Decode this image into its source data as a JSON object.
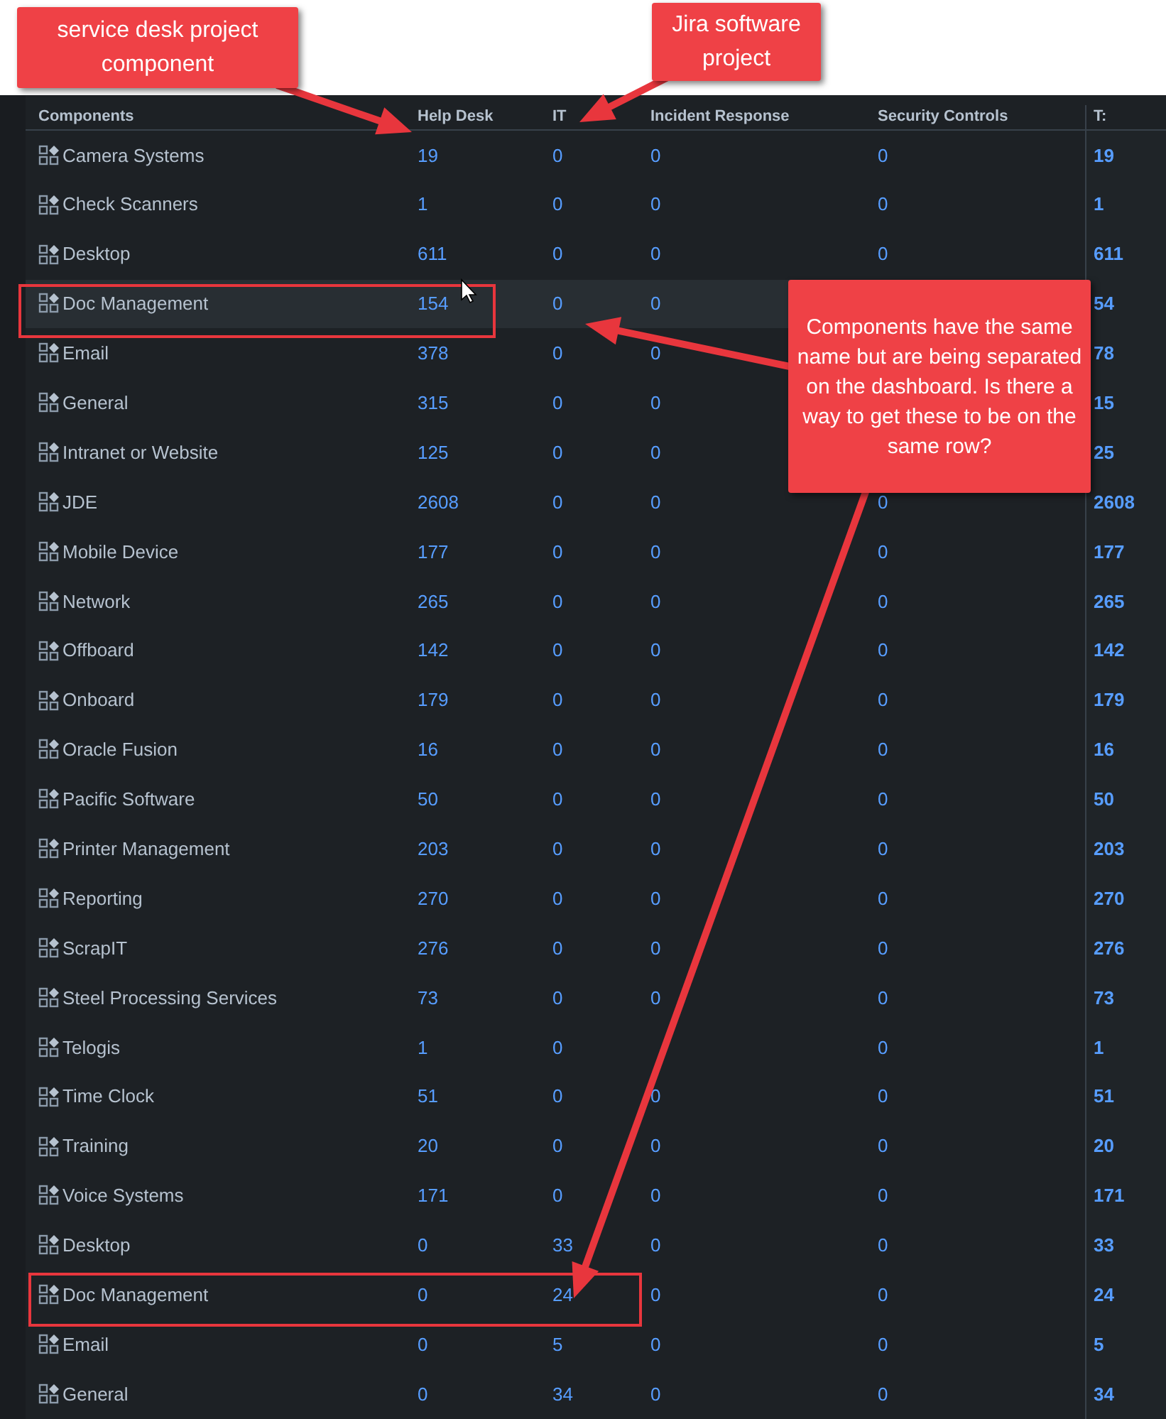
{
  "table": {
    "columns": [
      "Components",
      "Help Desk",
      "IT",
      "Incident Response",
      "Security Controls",
      "T:"
    ],
    "rows": [
      {
        "cells": [
          "Camera Systems",
          "19",
          "0",
          "0",
          "0",
          "19"
        ],
        "hovered": false
      },
      {
        "cells": [
          "Check Scanners",
          "1",
          "0",
          "0",
          "0",
          "1"
        ],
        "hovered": false
      },
      {
        "cells": [
          "Desktop",
          "611",
          "0",
          "0",
          "0",
          "611"
        ],
        "hovered": false
      },
      {
        "cells": [
          "Doc Management",
          "154",
          "0",
          "0",
          null,
          "54"
        ],
        "hovered": true
      },
      {
        "cells": [
          "Email",
          "378",
          "0",
          "0",
          null,
          "78"
        ],
        "hovered": false
      },
      {
        "cells": [
          "General",
          "315",
          "0",
          "0",
          null,
          "15"
        ],
        "hovered": false
      },
      {
        "cells": [
          "Intranet or Website",
          "125",
          "0",
          "0",
          null,
          "25"
        ],
        "hovered": false
      },
      {
        "cells": [
          "JDE",
          "2608",
          "0",
          "0",
          "0",
          "2608"
        ],
        "hovered": false
      },
      {
        "cells": [
          "Mobile Device",
          "177",
          "0",
          "0",
          "0",
          "177"
        ],
        "hovered": false
      },
      {
        "cells": [
          "Network",
          "265",
          "0",
          "0",
          "0",
          "265"
        ],
        "hovered": false
      },
      {
        "cells": [
          "Offboard",
          "142",
          "0",
          "0",
          "0",
          "142"
        ],
        "hovered": false
      },
      {
        "cells": [
          "Onboard",
          "179",
          "0",
          "0",
          "0",
          "179"
        ],
        "hovered": false
      },
      {
        "cells": [
          "Oracle Fusion",
          "16",
          "0",
          "0",
          "0",
          "16"
        ],
        "hovered": false
      },
      {
        "cells": [
          "Pacific Software",
          "50",
          "0",
          "0",
          "0",
          "50"
        ],
        "hovered": false
      },
      {
        "cells": [
          "Printer Management",
          "203",
          "0",
          "0",
          "0",
          "203"
        ],
        "hovered": false
      },
      {
        "cells": [
          "Reporting",
          "270",
          "0",
          "0",
          "0",
          "270"
        ],
        "hovered": false
      },
      {
        "cells": [
          "ScrapIT",
          "276",
          "0",
          "0",
          "0",
          "276"
        ],
        "hovered": false
      },
      {
        "cells": [
          "Steel Processing Services",
          "73",
          "0",
          "0",
          "0",
          "73"
        ],
        "hovered": false
      },
      {
        "cells": [
          "Telogis",
          "1",
          "0",
          null,
          "0",
          "1"
        ],
        "hovered": false
      },
      {
        "cells": [
          "Time Clock",
          "51",
          "0",
          "0",
          "0",
          "51"
        ],
        "hovered": false
      },
      {
        "cells": [
          "Training",
          "20",
          "0",
          "0",
          "0",
          "20"
        ],
        "hovered": false
      },
      {
        "cells": [
          "Voice Systems",
          "171",
          "0",
          "0",
          "0",
          "171"
        ],
        "hovered": false
      },
      {
        "cells": [
          "Desktop",
          "0",
          "33",
          "0",
          "0",
          "33"
        ],
        "hovered": false
      },
      {
        "cells": [
          "Doc Management",
          "0",
          "24",
          "0",
          "0",
          "24"
        ],
        "hovered": false
      },
      {
        "cells": [
          "Email",
          "0",
          "5",
          "0",
          "0",
          "5"
        ],
        "hovered": false
      },
      {
        "cells": [
          "General",
          "0",
          "34",
          "0",
          "0",
          "34"
        ],
        "hovered": false
      }
    ]
  },
  "annotations": [
    {
      "text": "service desk project component"
    },
    {
      "text": "Jira software project"
    },
    {
      "text": "Components have the same name but are being separated on the dashboard.  Is there a way to get these to be on the same row?"
    }
  ]
}
